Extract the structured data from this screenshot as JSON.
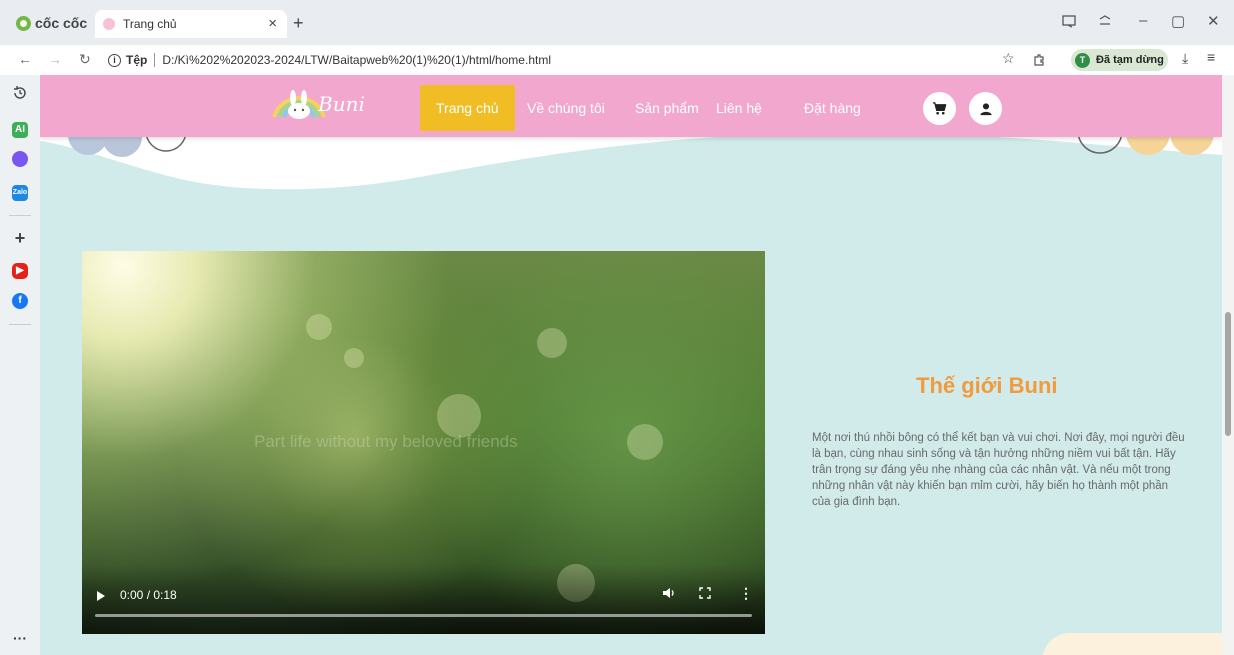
{
  "browser": {
    "brand": "cốc cốc",
    "tab_title": "Trang chủ",
    "tab_close": "×",
    "new_tab": "+",
    "address_label": "Tệp",
    "address_url": "D:/Kì%202%202023-2024/LTW/Baitapweb%20(1)%20(1)/html/home.html",
    "profile_initial": "T",
    "profile_status": "Đã tạm dừng",
    "win_min": "–",
    "win_restore": "▢",
    "win_close": "✕",
    "nav_back": "←",
    "nav_forward": "→",
    "nav_reload": "↻",
    "bookmark_icon": "☆",
    "download_icon": "⤓",
    "menu_icon": "≡",
    "sidebar_more": "···",
    "sidebar_add": "+",
    "sidebar_ai": "AI"
  },
  "site": {
    "logo_text": "Buni",
    "menu": [
      {
        "label": "Trang chủ",
        "active": true
      },
      {
        "label": "Về chúng tôi",
        "active": false
      },
      {
        "label": "Sản phẩm",
        "active": false
      },
      {
        "label": "Liên hệ",
        "active": false
      },
      {
        "label": "Đặt hàng",
        "active": false
      }
    ],
    "colors": {
      "header": "#f2a7cf",
      "active_menu": "#f0be24",
      "page_bg": "#d1eaea",
      "title": "#f19b3c"
    }
  },
  "video": {
    "caption": "Part life without my beloved friends",
    "time": "0:00 / 0:18",
    "progress": 0
  },
  "world": {
    "title": "Thế giới Buni",
    "description": "Một nơi thú nhồi bông có thể kết bạn và vui chơi. Nơi đây, mọi người đều là bạn, cùng nhau sinh sống và tận hưởng những niềm vui bất tận. Hãy trân trọng sự đáng yêu nhẹ nhàng của các nhân vật. Và nếu một trong những nhân vật này khiến bạn mỉm cười, hãy biến họ thành một phần của gia đình bạn."
  }
}
